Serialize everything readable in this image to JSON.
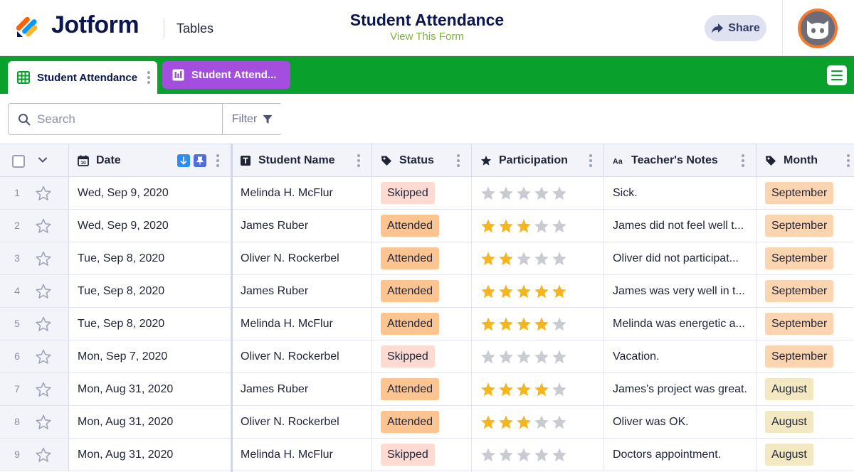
{
  "header": {
    "brand": "Jotform",
    "product": "Tables",
    "form_title": "Student Attendance",
    "form_link": "View This Form",
    "share_label": "Share",
    "brand_colors": {
      "navy": "#0a1551",
      "green": "#09a12c",
      "purple": "#a44ee0",
      "orange": "#f37a2f"
    }
  },
  "tabs": [
    {
      "label": "Student Attendance",
      "icon": "table-grid-icon",
      "active": true
    },
    {
      "label": "Student Attend...",
      "icon": "report-bars-icon",
      "active": false
    }
  ],
  "toolbar": {
    "search_placeholder": "Search",
    "filter_label": "Filter"
  },
  "columns": [
    {
      "label": "Date",
      "icon": "calendar-icon"
    },
    {
      "label": "Student Name",
      "icon": "text-field-icon"
    },
    {
      "label": "Status",
      "icon": "tag-icon"
    },
    {
      "label": "Participation",
      "icon": "star-icon"
    },
    {
      "label": "Teacher's Notes",
      "icon": "long-text-icon"
    },
    {
      "label": "Month",
      "icon": "tag-icon"
    }
  ],
  "rows": [
    {
      "num": "1",
      "date": "Wed, Sep 9, 2020",
      "name": "Melinda H. McFlur",
      "status": "Skipped",
      "rating": 0,
      "note": "Sick.",
      "month": "September"
    },
    {
      "num": "2",
      "date": "Wed, Sep 9, 2020",
      "name": "James Ruber",
      "status": "Attended",
      "rating": 3,
      "note": "James did not feel well t...",
      "month": "September"
    },
    {
      "num": "3",
      "date": "Tue, Sep 8, 2020",
      "name": "Oliver N. Rockerbel",
      "status": "Attended",
      "rating": 2,
      "note": "Oliver did not participat...",
      "month": "September"
    },
    {
      "num": "4",
      "date": "Tue, Sep 8, 2020",
      "name": "James Ruber",
      "status": "Attended",
      "rating": 5,
      "note": "James was very well in t...",
      "month": "September"
    },
    {
      "num": "5",
      "date": "Tue, Sep 8, 2020",
      "name": "Melinda H. McFlur",
      "status": "Attended",
      "rating": 4,
      "note": "Melinda was energetic a...",
      "month": "September"
    },
    {
      "num": "6",
      "date": "Mon, Sep 7, 2020",
      "name": "Oliver N. Rockerbel",
      "status": "Skipped",
      "rating": 0,
      "note": "Vacation.",
      "month": "September"
    },
    {
      "num": "7",
      "date": "Mon, Aug 31, 2020",
      "name": "James Ruber",
      "status": "Attended",
      "rating": 4,
      "note": "James's project was great.",
      "month": "August"
    },
    {
      "num": "8",
      "date": "Mon, Aug 31, 2020",
      "name": "Oliver N. Rockerbel",
      "status": "Attended",
      "rating": 3,
      "note": "Oliver was OK.",
      "month": "August"
    },
    {
      "num": "9",
      "date": "Mon, Aug 31, 2020",
      "name": "Melinda H. McFlur",
      "status": "Skipped",
      "rating": 0,
      "note": "Doctors appointment.",
      "month": "August"
    }
  ],
  "colors": {
    "star_filled": "#f4b51d",
    "star_empty": "#c9cbd3",
    "skipped": "#fddbd2",
    "attended": "#fbc491",
    "september": "#fbd4b0",
    "august": "#f2e8c2"
  }
}
